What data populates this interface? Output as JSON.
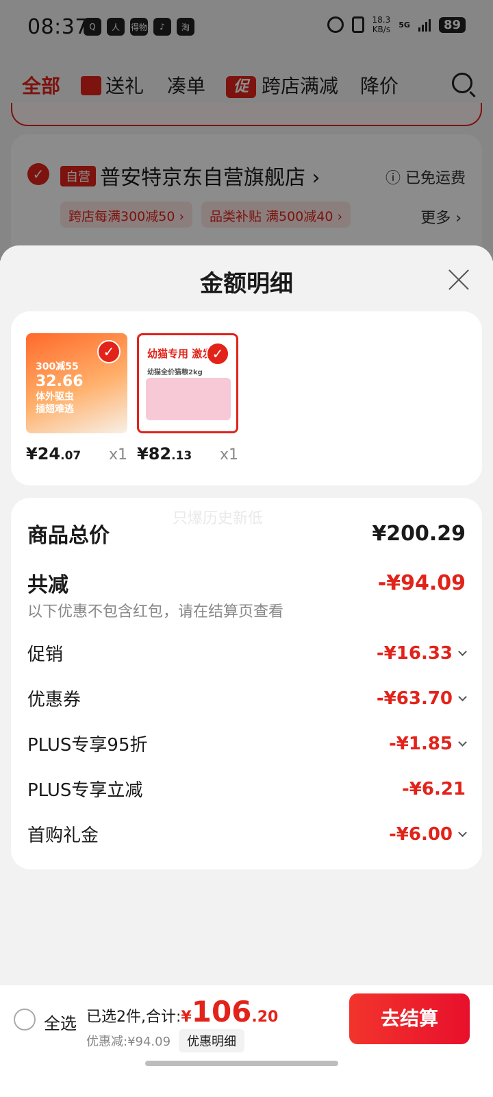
{
  "status_bar": {
    "time": "08:37",
    "apps": [
      "Q",
      "人",
      "得物",
      "♪",
      "淘"
    ],
    "net_speed": "18.3",
    "net_unit": "KB/s",
    "network": "5G",
    "battery": "89"
  },
  "category_tabs": [
    {
      "label": "全部",
      "active": true
    },
    {
      "label": "送礼",
      "icon": "gift-icon"
    },
    {
      "label": "凑单"
    },
    {
      "label": "跨店满减",
      "icon": "promo-icon",
      "icon_text": "促"
    },
    {
      "label": "降价"
    }
  ],
  "store": {
    "badge": "自营",
    "name": "普安特京东自营旗舰店 ›",
    "shipping": "ⓘ 已免运费",
    "chips": [
      "跨店每满300减50 ›",
      "品类补贴 满500减40 ›"
    ],
    "more": "更多 ›"
  },
  "sheet": {
    "title": "金额明细",
    "products": [
      {
        "price_int": "¥24",
        "price_dec": ".07",
        "qty": "x1",
        "thumb_text": [
          "300减55",
          "32.66",
          "体外驱虫",
          "插翅难逃"
        ]
      },
      {
        "price_int": "¥82",
        "price_dec": ".13",
        "qty": "x1",
        "thumb_text": [
          "幼猫专用 激发自",
          "幼猫全价猫粮2kg"
        ]
      }
    ],
    "watermark": "只爆历史新低",
    "total": {
      "label": "商品总价",
      "value": "¥200.29"
    },
    "reduction": {
      "label": "共减",
      "value": "-¥94.09",
      "note": "以下优惠不包含红包，请在结算页查看"
    },
    "items": [
      {
        "label": "促销",
        "value": "-¥16.33",
        "expand": true
      },
      {
        "label": "优惠券",
        "value": "-¥63.70",
        "expand": true
      },
      {
        "label": "PLUS专享95折",
        "value": "-¥1.85",
        "expand": true
      },
      {
        "label": "PLUS专享立减",
        "value": "-¥6.21",
        "expand": false
      },
      {
        "label": "首购礼金",
        "value": "-¥6.00",
        "expand": true
      }
    ]
  },
  "bottom_bar": {
    "select_all": "全选",
    "selected_text": "已选2件,合计:",
    "currency": "¥",
    "total_int": "106",
    "total_dec": ".20",
    "discount_text": "优惠减:¥94.09",
    "detail_button": "优惠明细",
    "checkout_button": "去结算"
  },
  "colors": {
    "accent": "#e2231a",
    "background": "#f2f2f2",
    "card": "#ffffff"
  }
}
